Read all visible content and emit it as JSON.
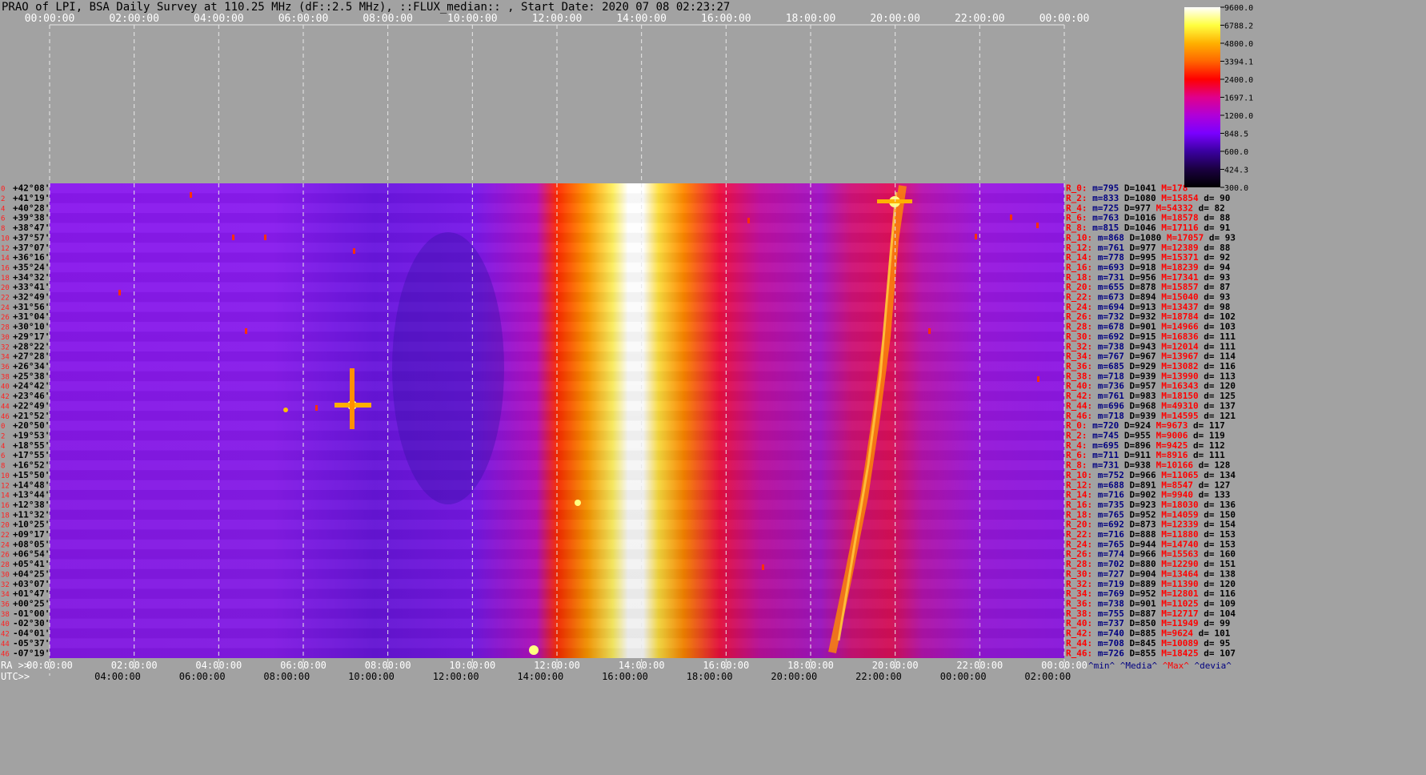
{
  "chart_data": {
    "type": "heatmap",
    "title": "PRAO of LPI, BSA Daily Survey at 110.25 MHz (dF::2.5 MHz), ::FLUX_median:: , Start Date: 2020 07 08 02:23:27",
    "top_time_ticks": [
      "00:00:00",
      "02:00:00",
      "04:00:00",
      "06:00:00",
      "08:00:00",
      "10:00:00",
      "12:00:00",
      "14:00:00",
      "16:00:00",
      "18:00:00",
      "20:00:00",
      "22:00:00",
      "00:00:00"
    ],
    "ra_axis_label": "RA >>",
    "ra_ticks": [
      "00:00:00",
      "02:00:00",
      "04:00:00",
      "06:00:00",
      "08:00:00",
      "10:00:00",
      "12:00:00",
      "14:00:00",
      "16:00:00",
      "18:00:00",
      "20:00:00",
      "22:00:00",
      "00:00:00"
    ],
    "utc_axis_label": "UTC>>",
    "utc_ticks": [
      "04:00:00",
      "06:00:00",
      "08:00:00",
      "10:00:00",
      "12:00:00",
      "14:00:00",
      "16:00:00",
      "18:00:00",
      "20:00:00",
      "22:00:00",
      "00:00:00",
      "02:00:00"
    ],
    "colorbar": {
      "ticks": [
        "9600.0",
        "6788.2",
        "4800.0",
        "3394.1",
        "2400.0",
        "1697.1",
        "1200.0",
        "848.5",
        "600.0",
        "424.3",
        "300.0"
      ],
      "colormap": [
        "#000000",
        "#1a0040",
        "#3a00a0",
        "#7a00ff",
        "#b000d8",
        "#e0008c",
        "#ff0000",
        "#ff6600",
        "#ffb000",
        "#ffff40",
        "#ffffff"
      ]
    },
    "rows": [
      {
        "idx": "0",
        "dec": "+42°08'",
        "stat": "R_0:",
        "min": "795",
        "med": "1041",
        "max": "178",
        "dev": ""
      },
      {
        "idx": "2",
        "dec": "+41°19'",
        "stat": "R_2:",
        "min": "833",
        "med": "1080",
        "max": "15854",
        "dev": "90"
      },
      {
        "idx": "4",
        "dec": "+40°28'",
        "stat": "R_4:",
        "min": "725",
        "med": "977",
        "max": "54332",
        "dev": "82"
      },
      {
        "idx": "6",
        "dec": "+39°38'",
        "stat": "R_6:",
        "min": "763",
        "med": "1016",
        "max": "18578",
        "dev": "88"
      },
      {
        "idx": "8",
        "dec": "+38°47'",
        "stat": "R_8:",
        "min": "815",
        "med": "1046",
        "max": "17116",
        "dev": "91"
      },
      {
        "idx": "10",
        "dec": "+37°57'",
        "stat": "R_10:",
        "min": "868",
        "med": "1080",
        "max": "17057",
        "dev": "93"
      },
      {
        "idx": "12",
        "dec": "+37°07'",
        "stat": "R_12:",
        "min": "761",
        "med": "977",
        "max": "12389",
        "dev": "88"
      },
      {
        "idx": "14",
        "dec": "+36°16'",
        "stat": "R_14:",
        "min": "778",
        "med": "995",
        "max": "15371",
        "dev": "92"
      },
      {
        "idx": "16",
        "dec": "+35°24'",
        "stat": "R_16:",
        "min": "693",
        "med": "918",
        "max": "18239",
        "dev": "94"
      },
      {
        "idx": "18",
        "dec": "+34°32'",
        "stat": "R_18:",
        "min": "731",
        "med": "956",
        "max": "17341",
        "dev": "93"
      },
      {
        "idx": "20",
        "dec": "+33°41'",
        "stat": "R_20:",
        "min": "655",
        "med": "878",
        "max": "15857",
        "dev": "87"
      },
      {
        "idx": "22",
        "dec": "+32°49'",
        "stat": "R_22:",
        "min": "673",
        "med": "894",
        "max": "15040",
        "dev": "93"
      },
      {
        "idx": "24",
        "dec": "+31°56'",
        "stat": "R_24:",
        "min": "694",
        "med": "913",
        "max": "13437",
        "dev": "98"
      },
      {
        "idx": "26",
        "dec": "+31°04'",
        "stat": "R_26:",
        "min": "732",
        "med": "932",
        "max": "18784",
        "dev": "102"
      },
      {
        "idx": "28",
        "dec": "+30°10'",
        "stat": "R_28:",
        "min": "678",
        "med": "901",
        "max": "14966",
        "dev": "103"
      },
      {
        "idx": "30",
        "dec": "+29°17'",
        "stat": "R_30:",
        "min": "692",
        "med": "915",
        "max": "16836",
        "dev": "111"
      },
      {
        "idx": "32",
        "dec": "+28°22'",
        "stat": "R_32:",
        "min": "738",
        "med": "943",
        "max": "12014",
        "dev": "111"
      },
      {
        "idx": "34",
        "dec": "+27°28'",
        "stat": "R_34:",
        "min": "767",
        "med": "967",
        "max": "13967",
        "dev": "114"
      },
      {
        "idx": "36",
        "dec": "+26°34'",
        "stat": "R_36:",
        "min": "685",
        "med": "929",
        "max": "13082",
        "dev": "116"
      },
      {
        "idx": "38",
        "dec": "+25°38'",
        "stat": "R_38:",
        "min": "718",
        "med": "939",
        "max": "13990",
        "dev": "113"
      },
      {
        "idx": "40",
        "dec": "+24°42'",
        "stat": "R_40:",
        "min": "736",
        "med": "957",
        "max": "16343",
        "dev": "120"
      },
      {
        "idx": "42",
        "dec": "+23°46'",
        "stat": "R_42:",
        "min": "761",
        "med": "983",
        "max": "18150",
        "dev": "125"
      },
      {
        "idx": "44",
        "dec": "+22°49'",
        "stat": "R_44:",
        "min": "696",
        "med": "968",
        "max": "49310",
        "dev": "137"
      },
      {
        "idx": "46",
        "dec": "+21°52'",
        "stat": "R_46:",
        "min": "718",
        "med": "939",
        "max": "14595",
        "dev": "121"
      },
      {
        "idx": "0",
        "dec": "+20°50'",
        "stat": "R_0:",
        "min": "720",
        "med": "924",
        "max": "9673",
        "dev": "117"
      },
      {
        "idx": "2",
        "dec": "+19°53'",
        "stat": "R_2:",
        "min": "745",
        "med": "955",
        "max": "9006",
        "dev": "119"
      },
      {
        "idx": "4",
        "dec": "+18°55'",
        "stat": "R_4:",
        "min": "695",
        "med": "896",
        "max": "9425",
        "dev": "112"
      },
      {
        "idx": "6",
        "dec": "+17°55'",
        "stat": "R_6:",
        "min": "711",
        "med": "911",
        "max": "8916",
        "dev": "111"
      },
      {
        "idx": "8",
        "dec": "+16°52'",
        "stat": "R_8:",
        "min": "731",
        "med": "938",
        "max": "10166",
        "dev": "128"
      },
      {
        "idx": "10",
        "dec": "+15°50'",
        "stat": "R_10:",
        "min": "752",
        "med": "966",
        "max": "11065",
        "dev": "134"
      },
      {
        "idx": "12",
        "dec": "+14°48'",
        "stat": "R_12:",
        "min": "688",
        "med": "891",
        "max": "8547",
        "dev": "127"
      },
      {
        "idx": "14",
        "dec": "+13°44'",
        "stat": "R_14:",
        "min": "716",
        "med": "902",
        "max": "9940",
        "dev": "133"
      },
      {
        "idx": "16",
        "dec": "+12°38'",
        "stat": "R_16:",
        "min": "735",
        "med": "923",
        "max": "18030",
        "dev": "136"
      },
      {
        "idx": "18",
        "dec": "+11°32'",
        "stat": "R_18:",
        "min": "765",
        "med": "952",
        "max": "14059",
        "dev": "150"
      },
      {
        "idx": "20",
        "dec": "+10°25'",
        "stat": "R_20:",
        "min": "692",
        "med": "873",
        "max": "12339",
        "dev": "154"
      },
      {
        "idx": "22",
        "dec": "+09°17'",
        "stat": "R_22:",
        "min": "716",
        "med": "888",
        "max": "11880",
        "dev": "153"
      },
      {
        "idx": "24",
        "dec": "+08°05'",
        "stat": "R_24:",
        "min": "765",
        "med": "944",
        "max": "14740",
        "dev": "153"
      },
      {
        "idx": "26",
        "dec": "+06°54'",
        "stat": "R_26:",
        "min": "774",
        "med": "966",
        "max": "15563",
        "dev": "160"
      },
      {
        "idx": "28",
        "dec": "+05°41'",
        "stat": "R_28:",
        "min": "702",
        "med": "880",
        "max": "12290",
        "dev": "151"
      },
      {
        "idx": "30",
        "dec": "+04°25'",
        "stat": "R_30:",
        "min": "727",
        "med": "904",
        "max": "13464",
        "dev": "138"
      },
      {
        "idx": "32",
        "dec": "+03°07'",
        "stat": "R_32:",
        "min": "719",
        "med": "889",
        "max": "11390",
        "dev": "120"
      },
      {
        "idx": "34",
        "dec": "+01°47'",
        "stat": "R_34:",
        "min": "769",
        "med": "952",
        "max": "12801",
        "dev": "116"
      },
      {
        "idx": "36",
        "dec": "+00°25'",
        "stat": "R_36:",
        "min": "738",
        "med": "901",
        "max": "11025",
        "dev": "109"
      },
      {
        "idx": "38",
        "dec": "-01°00'",
        "stat": "R_38:",
        "min": "755",
        "med": "887",
        "max": "12717",
        "dev": "104"
      },
      {
        "idx": "40",
        "dec": "-02°30'",
        "stat": "R_40:",
        "min": "737",
        "med": "850",
        "max": "11949",
        "dev": "99"
      },
      {
        "idx": "42",
        "dec": "-04°01'",
        "stat": "R_42:",
        "min": "740",
        "med": "885",
        "max": "9624",
        "dev": "101"
      },
      {
        "idx": "44",
        "dec": "-05°37'",
        "stat": "R_44:",
        "min": "708",
        "med": "845",
        "max": "10089",
        "dev": "95"
      },
      {
        "idx": "46",
        "dec": "-07°19'",
        "stat": "R_46:",
        "min": "726",
        "med": "855",
        "max": "18425",
        "dev": "107"
      }
    ],
    "stats_footer": {
      "min": "^min^",
      "median": "^Media^",
      "max": "^Max^",
      "dev": "^devia^"
    }
  }
}
